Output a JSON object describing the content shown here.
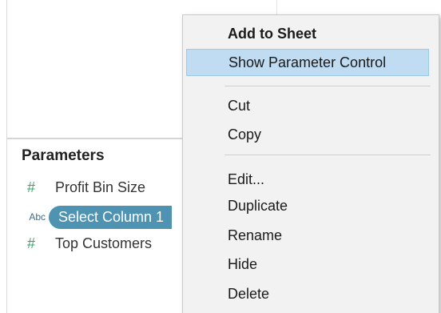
{
  "parameters_panel": {
    "title": "Parameters",
    "items": [
      {
        "type_icon": "#",
        "type_icon_name": "number-type-icon",
        "label": "Profit Bin Size",
        "selected": false
      },
      {
        "type_icon": "Abc",
        "type_icon_name": "string-type-icon",
        "label": "Select Column 1",
        "selected": true
      },
      {
        "type_icon": "#",
        "type_icon_name": "number-type-icon",
        "label": "Top Customers",
        "selected": false
      }
    ]
  },
  "context_menu": {
    "items": {
      "add_to_sheet": "Add to Sheet",
      "show_parameter_control": "Show Parameter Control",
      "cut": "Cut",
      "copy": "Copy",
      "edit": "Edit...",
      "duplicate": "Duplicate",
      "rename": "Rename",
      "hide": "Hide",
      "delete": "Delete"
    }
  },
  "colors": {
    "selection_pill": "#4e93b2",
    "menu_highlight": "#bfdcf2",
    "number_icon": "#3fa46a",
    "string_icon": "#3a6c8e"
  }
}
